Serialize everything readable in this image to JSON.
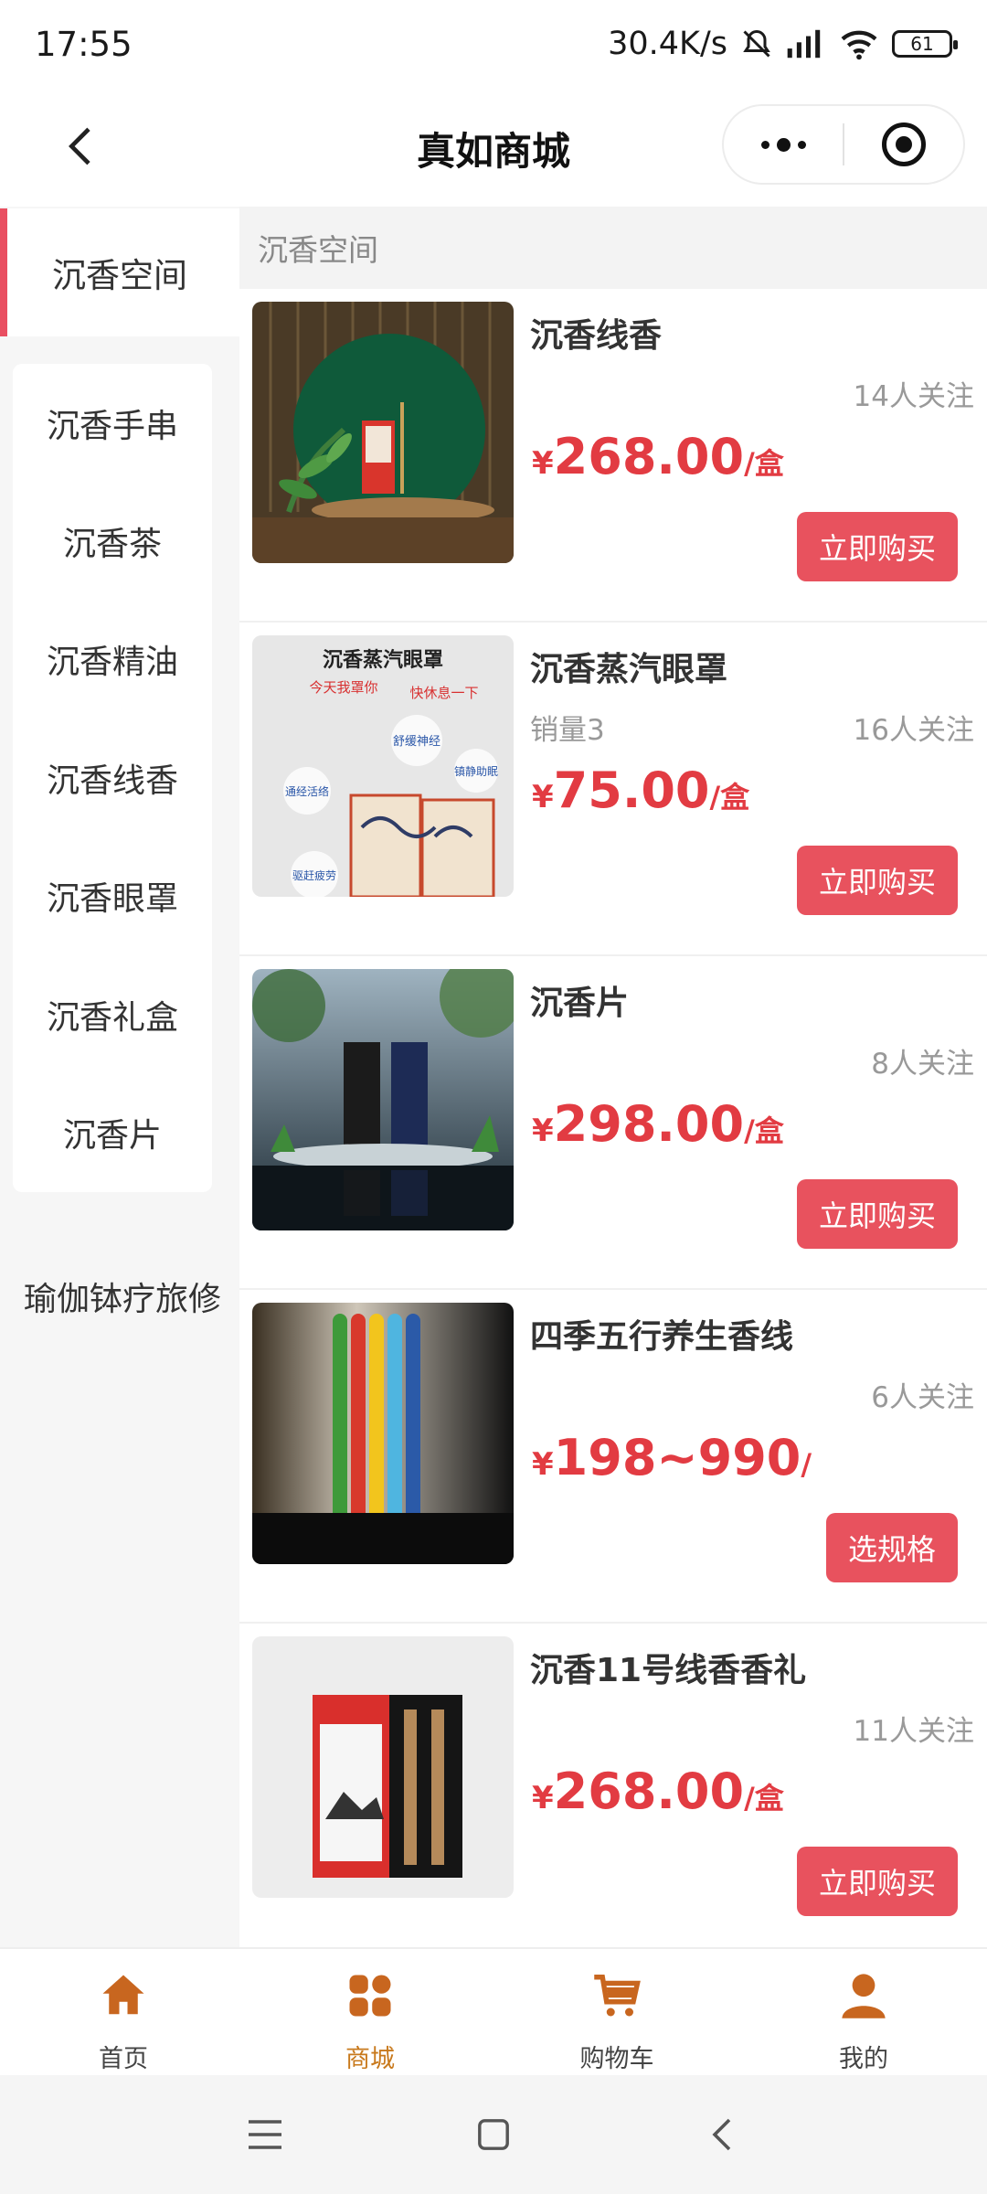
{
  "status_bar": {
    "time": "17:55",
    "speed": "30.4K/s",
    "battery": "61"
  },
  "nav": {
    "title": "真如商城"
  },
  "sidebar": {
    "active": "沉香空间",
    "sub_items": [
      "沉香手串",
      "沉香茶",
      "沉香精油",
      "沉香线香",
      "沉香眼罩",
      "沉香礼盒",
      "沉香片"
    ],
    "other": "瑜伽钵疗旅修"
  },
  "section_title": "沉香空间",
  "products": [
    {
      "name": "沉香线香",
      "sales": "",
      "followers": "14人关注",
      "currency": "¥",
      "price": "268.00",
      "unit": "/盒",
      "button": "立即购买"
    },
    {
      "name": "沉香蒸汽眼罩",
      "sales": "销量3",
      "followers": "16人关注",
      "currency": "¥",
      "price": "75.00",
      "unit": "/盒",
      "button": "立即购买"
    },
    {
      "name": "沉香片",
      "sales": "",
      "followers": "8人关注",
      "currency": "¥",
      "price": "298.00",
      "unit": "/盒",
      "button": "立即购买"
    },
    {
      "name": "四季五行养生香线",
      "sales": "",
      "followers": "6人关注",
      "currency": "¥",
      "price": "198~990",
      "unit": "/",
      "button": "选规格"
    },
    {
      "name": "沉香11号线香香礼",
      "sales": "",
      "followers": "11人关注",
      "currency": "¥",
      "price": "268.00",
      "unit": "/盒",
      "button": "立即购买"
    }
  ],
  "product_image_texts": {
    "eye_mask_title": "沉香蒸汽眼罩",
    "eye_mask_slogan_1": "今天我罩你",
    "eye_mask_slogan_2": "快休息一下",
    "eye_mask_bubble_1": "舒缓神经",
    "eye_mask_bubble_2": "通经活络",
    "eye_mask_bubble_3": "镇静助眠",
    "eye_mask_bubble_4": "驱赶疲劳"
  },
  "tabs": [
    {
      "label": "首页",
      "icon": "home-icon"
    },
    {
      "label": "商城",
      "icon": "grid-icon"
    },
    {
      "label": "购物车",
      "icon": "cart-icon"
    },
    {
      "label": "我的",
      "icon": "user-icon"
    }
  ],
  "colors": {
    "accent": "#e94f61",
    "price": "#e23b42",
    "button": "#e8525e",
    "tab_active": "#c8791c",
    "tab_icon": "#c8661f"
  }
}
